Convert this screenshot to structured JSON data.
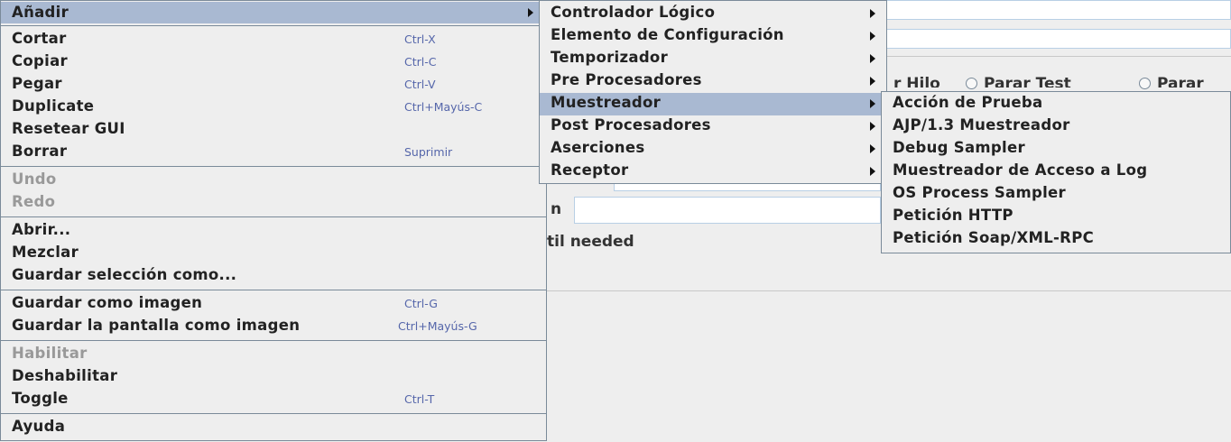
{
  "background": {
    "row_text": "r Hilo",
    "radio_stop_test": "Parar Test",
    "radio_stop_now": "Parar",
    "field_label_fragment": "n",
    "loop_text": "til needed"
  },
  "main_menu": {
    "items": [
      {
        "label": "Añadir",
        "accel": "",
        "submenu": true,
        "selected": true
      },
      {
        "label": "Cortar",
        "accel": "Ctrl-X"
      },
      {
        "label": "Copiar",
        "accel": "Ctrl-C"
      },
      {
        "label": "Pegar",
        "accel": "Ctrl-V"
      },
      {
        "label": "Duplicate",
        "accel": "Ctrl+Mayús-C"
      },
      {
        "label": "Resetear GUI",
        "accel": ""
      },
      {
        "label": "Borrar",
        "accel": "Suprimir"
      },
      {
        "label": "Undo",
        "accel": "",
        "disabled": true
      },
      {
        "label": "Redo",
        "accel": "",
        "disabled": true
      },
      {
        "label": "Abrir...",
        "accel": ""
      },
      {
        "label": "Mezclar",
        "accel": ""
      },
      {
        "label": "Guardar selección como...",
        "accel": ""
      },
      {
        "label": "Guardar como imagen",
        "accel": "Ctrl-G"
      },
      {
        "label": "Guardar la pantalla como imagen",
        "accel": "Ctrl+Mayús-G"
      },
      {
        "label": "Habilitar",
        "accel": "",
        "disabled": true
      },
      {
        "label": "Deshabilitar",
        "accel": ""
      },
      {
        "label": "Toggle",
        "accel": "Ctrl-T"
      },
      {
        "label": "Ayuda",
        "accel": ""
      }
    ]
  },
  "add_submenu": {
    "items": [
      {
        "label": "Controlador Lógico"
      },
      {
        "label": "Elemento de Configuración"
      },
      {
        "label": "Temporizador"
      },
      {
        "label": "Pre Procesadores"
      },
      {
        "label": "Muestreador",
        "selected": true
      },
      {
        "label": "Post Procesadores"
      },
      {
        "label": "Aserciones"
      },
      {
        "label": "Receptor"
      }
    ]
  },
  "sampler_submenu": {
    "items": [
      {
        "label": "Acción de Prueba"
      },
      {
        "label": "AJP/1.3 Muestreador"
      },
      {
        "label": "Debug Sampler"
      },
      {
        "label": "Muestreador de Acceso a Log"
      },
      {
        "label": "OS Process Sampler"
      },
      {
        "label": "Petición HTTP"
      },
      {
        "label": "Petición Soap/XML-RPC"
      }
    ]
  }
}
